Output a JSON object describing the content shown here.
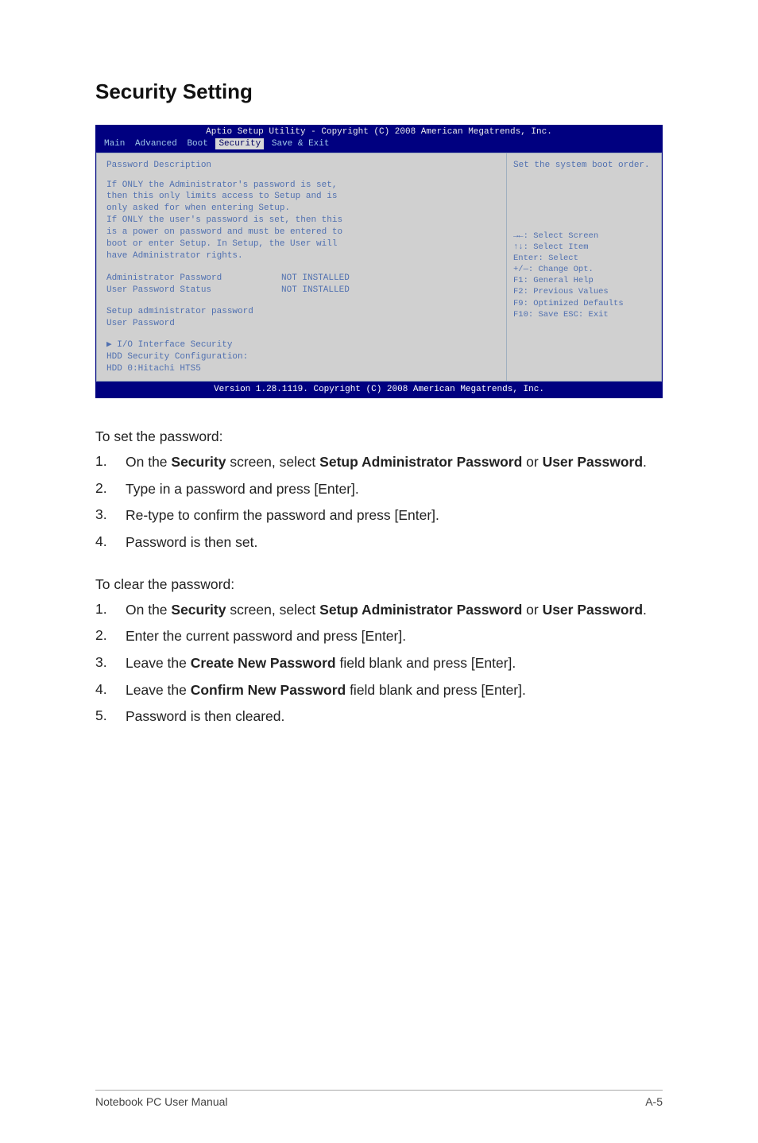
{
  "page_title": "Security Setting",
  "bios": {
    "header": "Aptio Setup Utility - Copyright (C) 2008 American Megatrends, Inc.",
    "tabs": {
      "main": "Main",
      "advanced": "Advanced",
      "boot": "Boot",
      "security": "Security",
      "save_exit": "Save & Exit"
    },
    "left": {
      "title": "Password Description",
      "desc_l1": "If ONLY the Administrator's password is set,",
      "desc_l2": "then this only limits access to Setup and is",
      "desc_l3": "only asked for when entering Setup.",
      "desc_l4": "If ONLY the user's password is set, then this",
      "desc_l5": "is a power on password and must be entered to",
      "desc_l6": "boot or enter Setup. In Setup, the User will",
      "desc_l7": "have Administrator rights.",
      "admin_pw_k": "Administrator Password",
      "admin_pw_v": "NOT INSTALLED",
      "user_pw_status_k": "User Password Status",
      "user_pw_status_v": "NOT INSTALLED",
      "setup_admin_pw": "Setup administrator password",
      "user_pw": "User Password",
      "io_sec": "I/O Interface Security",
      "hdd_cfg": "HDD Security Configuration:",
      "hdd_item": "HDD 0:Hitachi HTS5"
    },
    "right": {
      "help_top": "Set the system boot order.",
      "nav_l1": "→←: Select Screen",
      "nav_l2": "↑↓:    Select Item",
      "nav_l3": "Enter: Select",
      "nav_l4": "+/—:  Change Opt.",
      "nav_l5": "F1:    General Help",
      "nav_l6": "F2:    Previous Values",
      "nav_l7": "F9:    Optimized Defaults",
      "nav_l8": "F10:   Save   ESC: Exit"
    },
    "footer": "Version 1.28.1119. Copyright (C) 2008 American Megatrends, Inc."
  },
  "section1": {
    "intro": "To set the password:",
    "items": {
      "n1": "1.",
      "t1a": "On the ",
      "t1b": "Security",
      "t1c": " screen, select ",
      "t1d": "Setup Administrator Password",
      "t1e": " or ",
      "t1f": "User Password",
      "t1g": ".",
      "n2": "2.",
      "t2": "Type in a password and press [Enter].",
      "n3": "3.",
      "t3": "Re-type to confirm the password and press [Enter].",
      "n4": "4.",
      "t4": "Password is then set."
    }
  },
  "section2": {
    "intro": "To clear the password:",
    "items": {
      "n1": "1.",
      "t1a": "On the ",
      "t1b": "Security",
      "t1c": " screen, select ",
      "t1d": "Setup Administrator Password",
      "t1e": " or ",
      "t1f": "User Password",
      "t1g": ".",
      "n2": "2.",
      "t2": "Enter the current password and press [Enter].",
      "n3": "3.",
      "t3a": "Leave the ",
      "t3b": "Create New Password",
      "t3c": " field blank and press [Enter].",
      "n4": "4.",
      "t4a": "Leave the ",
      "t4b": "Confirm New Password",
      "t4c": " field blank and press [Enter].",
      "n5": "5.",
      "t5": "Password is then cleared."
    }
  },
  "footer": {
    "left": "Notebook PC User Manual",
    "right": "A-5"
  }
}
